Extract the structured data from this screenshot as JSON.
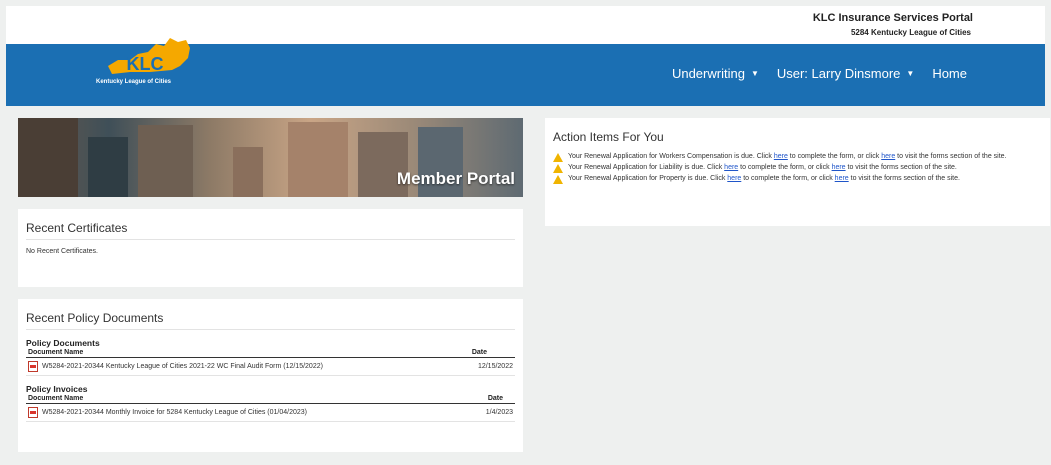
{
  "header": {
    "portal_title": "KLC Insurance Services Portal",
    "portal_subtitle": "5284 Kentucky League of Cities",
    "logo_text": "KLC",
    "logo_subtitle": "Kentucky League of Cities"
  },
  "nav": {
    "items": [
      {
        "label": "Underwriting",
        "has_caret": true
      },
      {
        "label": "User: Larry Dinsmore",
        "has_caret": true
      },
      {
        "label": "Home",
        "has_caret": false
      }
    ]
  },
  "banner": {
    "title": "Member Portal"
  },
  "recent_certificates": {
    "title": "Recent Certificates",
    "empty_text": "No Recent Certificates."
  },
  "recent_policy_documents": {
    "title": "Recent Policy Documents",
    "sections": [
      {
        "heading": "Policy Documents",
        "col_name": "Document Name",
        "col_date": "Date",
        "rows": [
          {
            "name": "W5284-2021-20344 Kentucky League of Cities 2021-22 WC Final Audit Form (12/15/2022)",
            "date": "12/15/2022"
          }
        ]
      },
      {
        "heading": "Policy Invoices",
        "col_name": "Document Name",
        "col_date": "Date",
        "rows": [
          {
            "name": "W5284-2021-20344 Monthly Invoice for 5284 Kentucky League of Cities (01/04/2023)",
            "date": "1/4/2023"
          }
        ]
      }
    ]
  },
  "action_items": {
    "title": "Action Items For You",
    "link_text": "here",
    "items": [
      {
        "pre": "Your Renewal Application for Workers Compensation is due. Click ",
        "mid": " to complete the form, or click ",
        "post": " to visit the forms section of the site."
      },
      {
        "pre": "Your Renewal Application for Liability is due. Click ",
        "mid": " to complete the form, or click ",
        "post": " to visit the forms section of the site."
      },
      {
        "pre": "Your Renewal Application for Property is due. Click ",
        "mid": " to complete the form, or click ",
        "post": " to visit the forms section of the site."
      }
    ]
  },
  "colors": {
    "nav_bg": "#1b6fb3",
    "logo_gold": "#f5a800",
    "link": "#1f55c9",
    "warning": "#f0b400",
    "pdf_red": "#d9342b"
  }
}
